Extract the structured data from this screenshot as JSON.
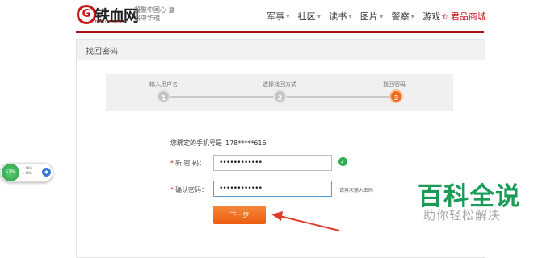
{
  "header": {
    "logo_mark": "G",
    "logo_text": "铁血网",
    "logo_sub": "TIEXUE.NET",
    "slogan": "凝聚中国心 复兴中华魂",
    "nav": [
      {
        "label": "军事"
      },
      {
        "label": "社区"
      },
      {
        "label": "读书"
      },
      {
        "label": "图片"
      },
      {
        "label": "警察"
      },
      {
        "label": "游戏"
      }
    ],
    "shop_label": "君品商城",
    "colors": {
      "brand": "#c8161d",
      "bar": "#a61216"
    }
  },
  "panel": {
    "title": "找回密码"
  },
  "steps": [
    {
      "label": "输入用户名",
      "number": "1"
    },
    {
      "label": "选择找回方式",
      "number": "2"
    },
    {
      "label": "找回密码",
      "number": "3"
    }
  ],
  "form": {
    "phone_label": "您绑定的手机号是",
    "phone_value": "178*****616",
    "new_password_label": "新 密 码：",
    "new_password_value": "••••••••••••",
    "confirm_password_label": "确认密码：",
    "confirm_password_value": "••••••••••••",
    "confirm_hint": "请再次输入密码",
    "next_button": "下一步"
  },
  "speed_widget": {
    "percent": "57%",
    "up": "0K/s",
    "down": "0K/s"
  },
  "watermark": {
    "title": "百科全说",
    "subtitle": "助你轻松解决"
  }
}
